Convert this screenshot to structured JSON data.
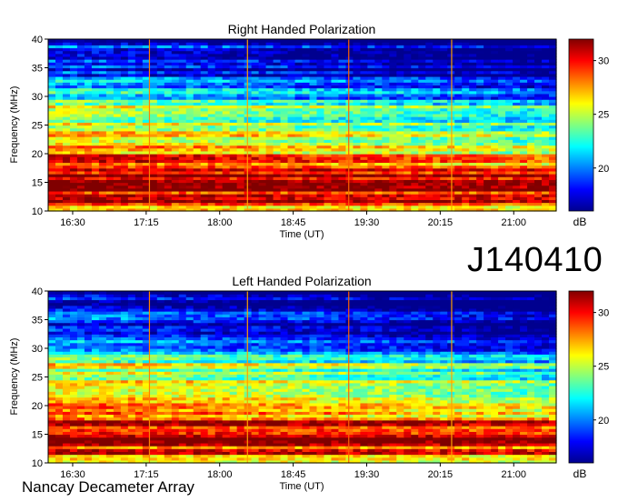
{
  "observation_id": "J140410",
  "instrument_label": "Nancay Decameter Array",
  "colormap": [
    "#00008f",
    "#0000ff",
    "#0080ff",
    "#00ffff",
    "#80ff80",
    "#ffff00",
    "#ff8000",
    "#ff0000",
    "#800000"
  ],
  "chart_data": [
    {
      "type": "heatmap",
      "title": "Right Handed Polarization",
      "xlabel": "Time (UT)",
      "ylabel": "Frequency (MHz)",
      "x_ticks": [
        "16:30",
        "17:15",
        "18:00",
        "18:45",
        "19:30",
        "20:15",
        "21:00"
      ],
      "x_tick_values_min": [
        990,
        1035,
        1080,
        1125,
        1170,
        1215,
        1260
      ],
      "x_range_min": [
        975,
        1286
      ],
      "y_ticks": [
        10,
        15,
        20,
        25,
        30,
        35,
        40
      ],
      "ylim": [
        10,
        40
      ],
      "colorbar_label": "dB",
      "colorbar_ticks": [
        20,
        25,
        30
      ],
      "color_range": [
        16,
        32
      ],
      "grid": false,
      "vertical_markers_min": [
        {
          "x": 1037,
          "color": "#ff8000"
        },
        {
          "x": 1097,
          "color": "#ffa000"
        },
        {
          "x": 1159,
          "color": "#ff6000"
        },
        {
          "x": 1222,
          "color": "#ffa000"
        }
      ],
      "spectrum_profile": [
        {
          "freq_mhz": 10,
          "db": 26
        },
        {
          "freq_mhz": 12,
          "db": 30
        },
        {
          "freq_mhz": 14,
          "db": 31
        },
        {
          "freq_mhz": 17,
          "db": 31
        },
        {
          "freq_mhz": 20,
          "db": 29
        },
        {
          "freq_mhz": 22,
          "db": 27
        },
        {
          "freq_mhz": 25,
          "db": 25
        },
        {
          "freq_mhz": 27,
          "db": 26
        },
        {
          "freq_mhz": 30,
          "db": 22
        },
        {
          "freq_mhz": 35,
          "db": 19
        },
        {
          "freq_mhz": 40,
          "db": 18
        }
      ]
    },
    {
      "type": "heatmap",
      "title": "Left Handed Polarization",
      "xlabel": "Time (UT)",
      "ylabel": "Frequency (MHz)",
      "x_ticks": [
        "16:30",
        "17:15",
        "18:00",
        "18:45",
        "19:30",
        "20:15",
        "21:00"
      ],
      "x_tick_values_min": [
        990,
        1035,
        1080,
        1125,
        1170,
        1215,
        1260
      ],
      "x_range_min": [
        975,
        1286
      ],
      "y_ticks": [
        10,
        15,
        20,
        25,
        30,
        35,
        40
      ],
      "ylim": [
        10,
        40
      ],
      "colorbar_label": "dB",
      "colorbar_ticks": [
        20,
        25,
        30
      ],
      "color_range": [
        16,
        32
      ],
      "grid": false,
      "vertical_markers_min": [
        {
          "x": 1037,
          "color": "#ff8000"
        },
        {
          "x": 1097,
          "color": "#ffa000"
        },
        {
          "x": 1159,
          "color": "#ff6000"
        },
        {
          "x": 1222,
          "color": "#ffa000"
        }
      ],
      "spectrum_profile": [
        {
          "freq_mhz": 10,
          "db": 26
        },
        {
          "freq_mhz": 12,
          "db": 30
        },
        {
          "freq_mhz": 14,
          "db": 31
        },
        {
          "freq_mhz": 17,
          "db": 31
        },
        {
          "freq_mhz": 20,
          "db": 29
        },
        {
          "freq_mhz": 22,
          "db": 27
        },
        {
          "freq_mhz": 25,
          "db": 25
        },
        {
          "freq_mhz": 27,
          "db": 26
        },
        {
          "freq_mhz": 30,
          "db": 22
        },
        {
          "freq_mhz": 35,
          "db": 19
        },
        {
          "freq_mhz": 40,
          "db": 18
        }
      ]
    }
  ]
}
